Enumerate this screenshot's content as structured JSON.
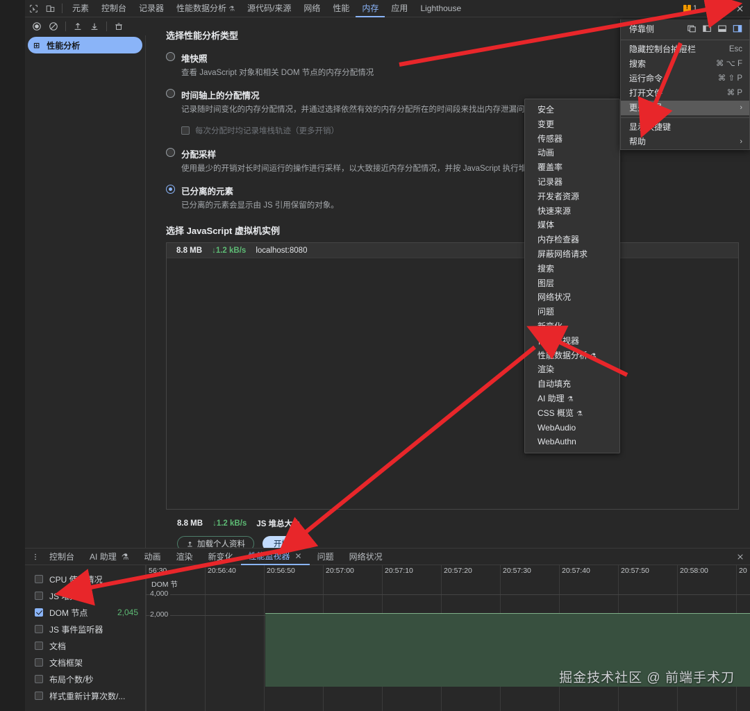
{
  "toolbar": {
    "icons": [
      "inspect-icon",
      "device-toolbar-icon"
    ],
    "tabs": [
      {
        "label": "元素",
        "active": false
      },
      {
        "label": "控制台",
        "active": false
      },
      {
        "label": "记录器",
        "active": false
      },
      {
        "label": "性能数据分析",
        "flask": "⚗",
        "active": false
      },
      {
        "label": "源代码/来源",
        "active": false
      },
      {
        "label": "网络",
        "active": false
      },
      {
        "label": "性能",
        "active": false
      },
      {
        "label": "内存",
        "active": true
      },
      {
        "label": "应用",
        "active": false
      },
      {
        "label": "Lighthouse",
        "active": false
      }
    ],
    "warning_count": "1",
    "right_icons": [
      "gear-icon",
      "kebab-menu-icon",
      "close-icon"
    ]
  },
  "sub_toolbar": {
    "icons": [
      "record-icon",
      "clear-icon",
      "load-icon",
      "save-icon",
      "trash-icon"
    ]
  },
  "sidebar": {
    "items": [
      {
        "icon": "profile-icon",
        "label": "性能分析",
        "selected": true
      }
    ]
  },
  "panel": {
    "section_title": "选择性能分析类型",
    "options": [
      {
        "label": "堆快照",
        "desc": "查看 JavaScript 对象和相关 DOM 节点的内存分配情况",
        "selected": false
      },
      {
        "label": "时间轴上的分配情况",
        "desc": "记录随时间变化的内存分配情况，并通过选择依然有效的内存分配所在的时间段来找出内存泄漏问题",
        "selected": false,
        "sub_checkbox": {
          "label": "每次分配时均记录堆栈轨迹（更多开销）",
          "checked": false,
          "disabled": true
        }
      },
      {
        "label": "分配采样",
        "desc": "使用最少的开销对长时间运行的操作进行采样，以大致接近内存分配情况，并按 JavaScript 执行堆栈获取细分结果",
        "selected": false
      },
      {
        "label": "已分离的元素",
        "desc": "已分离的元素会显示由 JS 引用保留的对象。",
        "selected": true
      }
    ],
    "vm_section_title": "选择 JavaScript 虚拟机实例",
    "vm_row": {
      "size": "8.8 MB",
      "rate": "↓1.2 kB/s",
      "url": "localhost:8080"
    },
    "footer": {
      "size": "8.8 MB",
      "rate": "↓1.2 kB/s",
      "label": "JS 堆总大小"
    },
    "buttons": {
      "load": "加载个人资料",
      "load_icon": "upload-icon",
      "start": "开始"
    }
  },
  "main_menu": {
    "dock_label": "停靠侧",
    "dock_options": [
      "dock-undocked-icon",
      "dock-left-icon",
      "dock-bottom-icon",
      "dock-right-icon"
    ],
    "dock_active_index": 3,
    "items": [
      {
        "label": "隐藏控制台抽屉栏",
        "key": "Esc",
        "highlight": false
      },
      {
        "label": "搜索",
        "key": "⌘ ⌥ F",
        "highlight": false
      },
      {
        "label": "运行命令",
        "key": "⌘ ⇧ P",
        "highlight": false
      },
      {
        "label": "打开文件",
        "key": "⌘ P",
        "highlight": false
      },
      {
        "label": "更多工具",
        "arrow": "›",
        "highlight": true
      }
    ],
    "items2": [
      {
        "label": "显示快捷键",
        "highlight": false
      },
      {
        "label": "帮助",
        "arrow": "›",
        "highlight": false
      }
    ]
  },
  "context_menu": {
    "items": [
      {
        "label": "安全"
      },
      {
        "label": "变更"
      },
      {
        "label": "传感器"
      },
      {
        "label": "动画"
      },
      {
        "label": "覆盖率"
      },
      {
        "label": "记录器"
      },
      {
        "label": "开发者资源"
      },
      {
        "label": "快速来源"
      },
      {
        "label": "媒体"
      },
      {
        "label": "内存检查器"
      },
      {
        "label": "屏蔽网络请求"
      },
      {
        "label": "搜索"
      },
      {
        "label": "图层"
      },
      {
        "label": "网络状况"
      },
      {
        "label": "问题"
      },
      {
        "label": "新变化"
      },
      {
        "label": "性能监视器"
      },
      {
        "label": "性能数据分析",
        "flask": "⚗"
      },
      {
        "label": "渲染"
      },
      {
        "label": "自动填充"
      },
      {
        "label": "AI 助理",
        "flask": "⚗"
      },
      {
        "label": "CSS 概览",
        "flask": "⚗"
      },
      {
        "label": "WebAudio"
      },
      {
        "label": "WebAuthn"
      }
    ]
  },
  "drawer": {
    "kebab_icon": "kebab-menu-icon",
    "tabs": [
      {
        "label": "控制台",
        "active": false
      },
      {
        "label": "AI 助理",
        "flask": "⚗",
        "active": false
      },
      {
        "label": "动画",
        "active": false
      },
      {
        "label": "渲染",
        "active": false
      },
      {
        "label": "新变化",
        "active": false
      },
      {
        "label": "性能监视器",
        "active": true,
        "closable": "✕"
      },
      {
        "label": "问题",
        "active": false
      },
      {
        "label": "网络状况",
        "active": false
      }
    ],
    "close_icon": "close-icon",
    "metrics": [
      {
        "label": "CPU 使用情况",
        "checked": false,
        "value": ""
      },
      {
        "label": "JS 堆大小",
        "checked": false,
        "value": ""
      },
      {
        "label": "DOM 节点",
        "checked": true,
        "value": "2,045"
      },
      {
        "label": "JS 事件监听器",
        "checked": false,
        "value": ""
      },
      {
        "label": "文档",
        "checked": false,
        "value": ""
      },
      {
        "label": "文档框架",
        "checked": false,
        "value": ""
      },
      {
        "label": "布局个数/秒",
        "checked": false,
        "value": ""
      },
      {
        "label": "样式重新计算次数/...",
        "checked": false,
        "value": ""
      }
    ]
  },
  "chart_data": {
    "type": "area",
    "title": "DOM 节点",
    "series_label": "DOM 节",
    "x": [
      "56:30",
      "20:56:40",
      "20:56:50",
      "20:57:00",
      "20:57:10",
      "20:57:20",
      "20:57:30",
      "20:57:40",
      "20:57:50",
      "20:58:00",
      "20"
    ],
    "ytick_labels": [
      "4,000",
      "2,000"
    ],
    "ylim": [
      0,
      5000
    ],
    "current_value": 2045,
    "values": [
      0,
      0,
      2045,
      2045,
      2045,
      2045,
      2045,
      2045,
      2045,
      2045,
      2045
    ],
    "xlabel": "",
    "ylabel": "",
    "grid": true,
    "fill_color": "#38503f",
    "line_color": "#7fb089"
  },
  "watermark": "掘金技术社区 @ 前端手术刀",
  "colors": {
    "accent": "#8ab4f8",
    "green": "#5dba74",
    "arrow": "#e8262a",
    "bg": "#282828",
    "menu_bg": "#333333"
  }
}
